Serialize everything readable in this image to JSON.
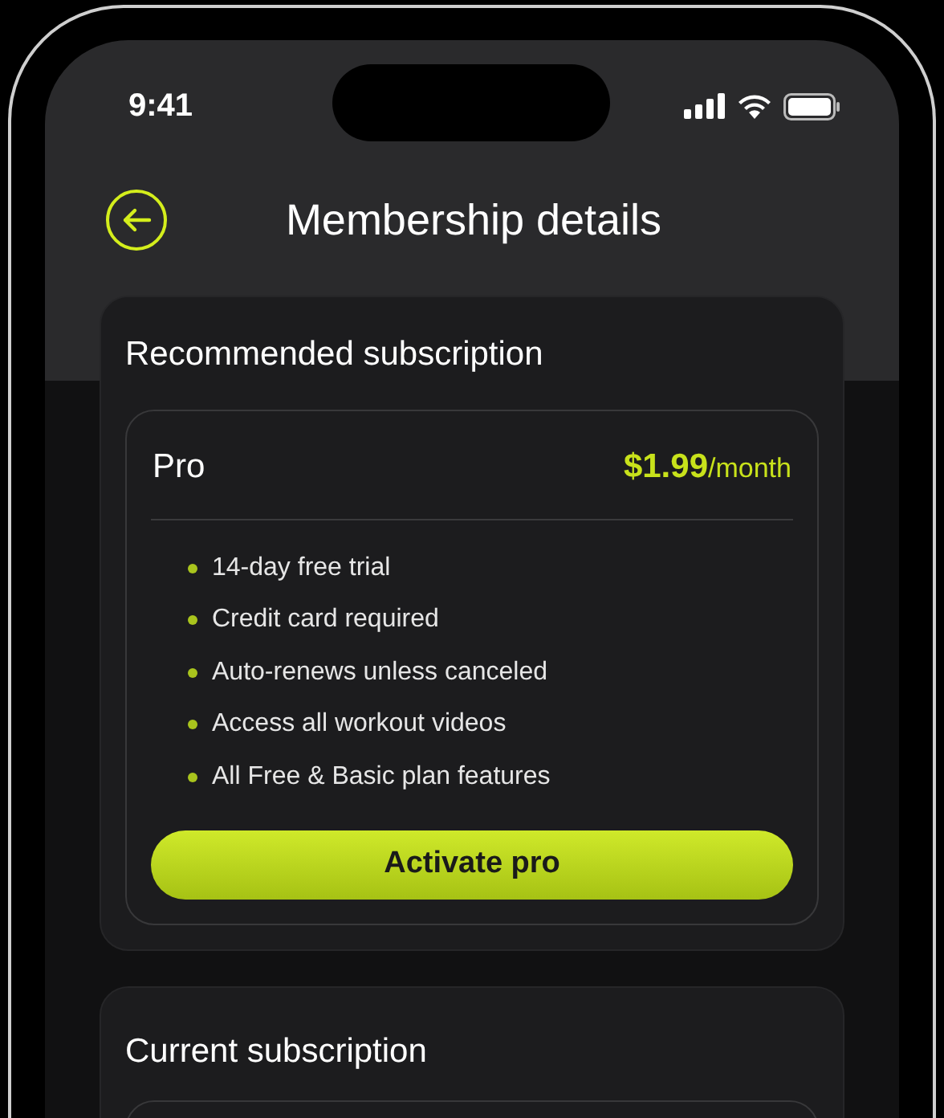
{
  "status_bar": {
    "time": "9:41"
  },
  "header": {
    "title": "Membership details"
  },
  "recommended": {
    "title": "Recommended subscription",
    "plan": {
      "name": "Pro",
      "price": "$1.99",
      "period": "/month",
      "features": [
        "14-day free trial",
        "Credit card required",
        "Auto-renews unless canceled",
        "Access all workout videos",
        "All Free & Basic plan features"
      ],
      "button": "Activate pro"
    }
  },
  "current": {
    "title": "Current subscription"
  }
}
